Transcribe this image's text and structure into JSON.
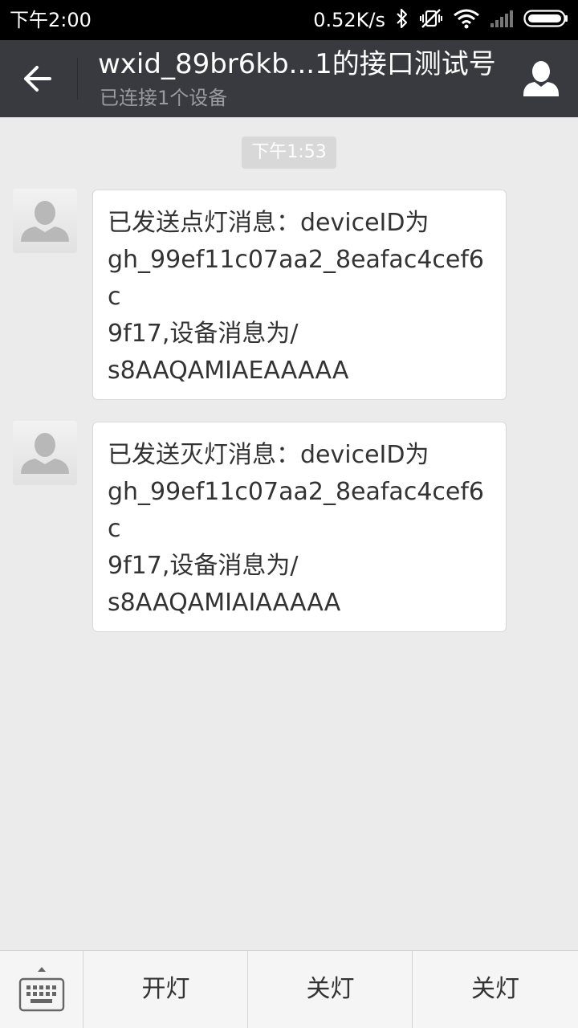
{
  "status_bar": {
    "time": "下午2:00",
    "net_speed": "0.52K/s",
    "icons": [
      "bluetooth-icon",
      "vibrate-off-icon",
      "wifi-icon",
      "signal-icon",
      "battery-icon"
    ]
  },
  "header": {
    "title": "wxid_89br6kb...1的接口测试号",
    "subtitle": "已连接1个设备",
    "back_icon": "arrow-left-icon",
    "profile_icon": "person-icon"
  },
  "chat": {
    "timestamp": "下午1:53",
    "messages": [
      {
        "lines": [
          "已发送点灯消息：deviceID为",
          "gh_99ef11c07aa2_8eafac4cef6c",
          "9f17,设备消息为/",
          "s8AAQAMIAEAAAAA"
        ]
      },
      {
        "lines": [
          "已发送灭灯消息：deviceID为",
          "gh_99ef11c07aa2_8eafac4cef6c",
          "9f17,设备消息为/",
          "s8AAQAMIAIAAAAA"
        ]
      }
    ]
  },
  "bottom_menu": {
    "keyboard_icon": "keyboard-icon",
    "items": [
      {
        "label": "开灯"
      },
      {
        "label": "关灯"
      },
      {
        "label": "关灯"
      }
    ]
  },
  "colors": {
    "header_bg": "#393a3f",
    "chat_bg": "#ebebeb",
    "bubble_bg": "#ffffff",
    "status_bar_bg": "#000000"
  }
}
